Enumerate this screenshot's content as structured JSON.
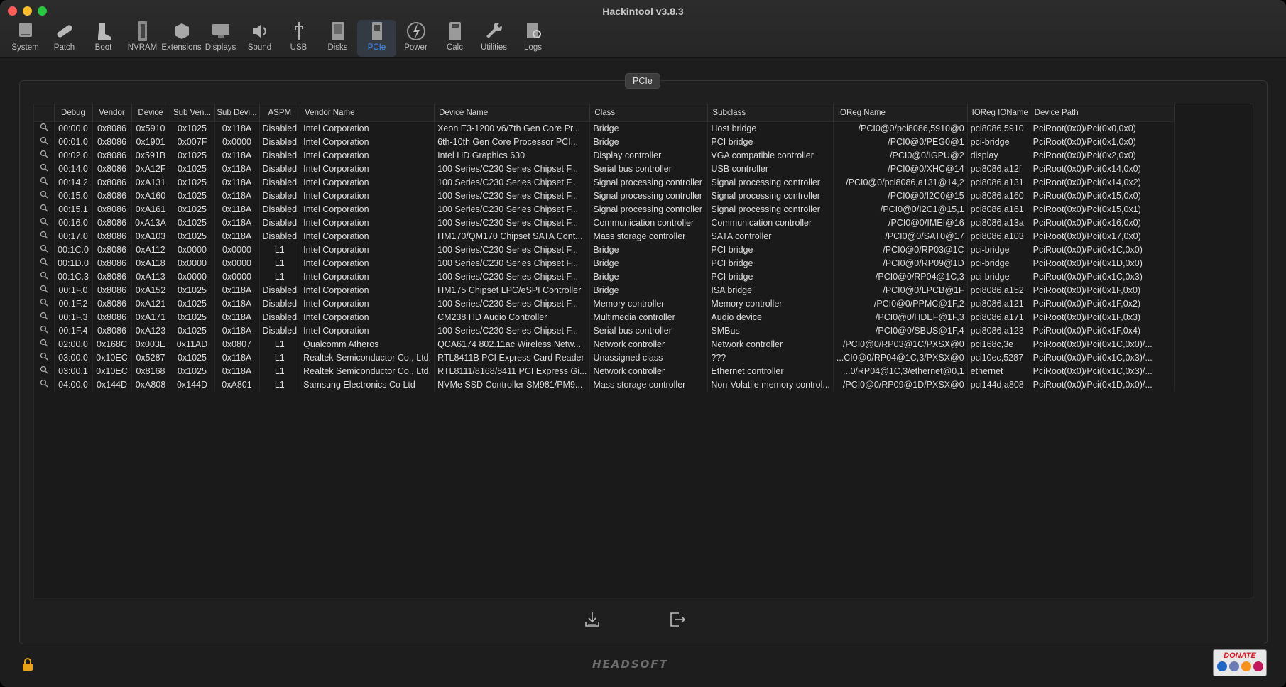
{
  "window": {
    "title": "Hackintool v3.8.3"
  },
  "toolbar": [
    {
      "label": "System",
      "icon": "system-icon"
    },
    {
      "label": "Patch",
      "icon": "patch-icon"
    },
    {
      "label": "Boot",
      "icon": "boot-icon"
    },
    {
      "label": "NVRAM",
      "icon": "nvram-icon"
    },
    {
      "label": "Extensions",
      "icon": "extensions-icon"
    },
    {
      "label": "Displays",
      "icon": "displays-icon"
    },
    {
      "label": "Sound",
      "icon": "sound-icon"
    },
    {
      "label": "USB",
      "icon": "usb-icon"
    },
    {
      "label": "Disks",
      "icon": "disks-icon"
    },
    {
      "label": "PCIe",
      "icon": "pcie-icon",
      "active": true
    },
    {
      "label": "Power",
      "icon": "power-icon"
    },
    {
      "label": "Calc",
      "icon": "calc-icon"
    },
    {
      "label": "Utilities",
      "icon": "utilities-icon"
    },
    {
      "label": "Logs",
      "icon": "logs-icon"
    }
  ],
  "panel": {
    "title": "PCIe"
  },
  "table": {
    "columns": [
      "",
      "Debug",
      "Vendor",
      "Device",
      "Sub Ven...",
      "Sub Devi...",
      "ASPM",
      "Vendor Name",
      "Device Name",
      "Class",
      "Subclass",
      "IOReg Name",
      "IOReg IOName",
      "Device Path"
    ],
    "rows": [
      [
        "00:00.0",
        "0x8086",
        "0x5910",
        "0x1025",
        "0x118A",
        "Disabled",
        "Intel Corporation",
        "Xeon E3-1200 v6/7th Gen Core Pr...",
        "Bridge",
        "Host bridge",
        "/PCI0@0/pci8086,5910@0",
        "pci8086,5910",
        "PciRoot(0x0)/Pci(0x0,0x0)"
      ],
      [
        "00:01.0",
        "0x8086",
        "0x1901",
        "0x007F",
        "0x0000",
        "Disabled",
        "Intel Corporation",
        "6th-10th Gen Core Processor PCI...",
        "Bridge",
        "PCI bridge",
        "/PCI0@0/PEG0@1",
        "pci-bridge",
        "PciRoot(0x0)/Pci(0x1,0x0)"
      ],
      [
        "00:02.0",
        "0x8086",
        "0x591B",
        "0x1025",
        "0x118A",
        "Disabled",
        "Intel Corporation",
        "Intel HD Graphics 630",
        "Display controller",
        "VGA compatible controller",
        "/PCI0@0/IGPU@2",
        "display",
        "PciRoot(0x0)/Pci(0x2,0x0)"
      ],
      [
        "00:14.0",
        "0x8086",
        "0xA12F",
        "0x1025",
        "0x118A",
        "Disabled",
        "Intel Corporation",
        "100 Series/C230 Series Chipset F...",
        "Serial bus controller",
        "USB controller",
        "/PCI0@0/XHC@14",
        "pci8086,a12f",
        "PciRoot(0x0)/Pci(0x14,0x0)"
      ],
      [
        "00:14.2",
        "0x8086",
        "0xA131",
        "0x1025",
        "0x118A",
        "Disabled",
        "Intel Corporation",
        "100 Series/C230 Series Chipset F...",
        "Signal processing controller",
        "Signal processing controller",
        "/PCI0@0/pci8086,a131@14,2",
        "pci8086,a131",
        "PciRoot(0x0)/Pci(0x14,0x2)"
      ],
      [
        "00:15.0",
        "0x8086",
        "0xA160",
        "0x1025",
        "0x118A",
        "Disabled",
        "Intel Corporation",
        "100 Series/C230 Series Chipset F...",
        "Signal processing controller",
        "Signal processing controller",
        "/PCI0@0/I2C0@15",
        "pci8086,a160",
        "PciRoot(0x0)/Pci(0x15,0x0)"
      ],
      [
        "00:15.1",
        "0x8086",
        "0xA161",
        "0x1025",
        "0x118A",
        "Disabled",
        "Intel Corporation",
        "100 Series/C230 Series Chipset F...",
        "Signal processing controller",
        "Signal processing controller",
        "/PCI0@0/I2C1@15,1",
        "pci8086,a161",
        "PciRoot(0x0)/Pci(0x15,0x1)"
      ],
      [
        "00:16.0",
        "0x8086",
        "0xA13A",
        "0x1025",
        "0x118A",
        "Disabled",
        "Intel Corporation",
        "100 Series/C230 Series Chipset F...",
        "Communication controller",
        "Communication controller",
        "/PCI0@0/IMEI@16",
        "pci8086,a13a",
        "PciRoot(0x0)/Pci(0x16,0x0)"
      ],
      [
        "00:17.0",
        "0x8086",
        "0xA103",
        "0x1025",
        "0x118A",
        "Disabled",
        "Intel Corporation",
        "HM170/QM170 Chipset SATA Cont...",
        "Mass storage controller",
        "SATA controller",
        "/PCI0@0/SAT0@17",
        "pci8086,a103",
        "PciRoot(0x0)/Pci(0x17,0x0)"
      ],
      [
        "00:1C.0",
        "0x8086",
        "0xA112",
        "0x0000",
        "0x0000",
        "L1",
        "Intel Corporation",
        "100 Series/C230 Series Chipset F...",
        "Bridge",
        "PCI bridge",
        "/PCI0@0/RP03@1C",
        "pci-bridge",
        "PciRoot(0x0)/Pci(0x1C,0x0)"
      ],
      [
        "00:1D.0",
        "0x8086",
        "0xA118",
        "0x0000",
        "0x0000",
        "L1",
        "Intel Corporation",
        "100 Series/C230 Series Chipset F...",
        "Bridge",
        "PCI bridge",
        "/PCI0@0/RP09@1D",
        "pci-bridge",
        "PciRoot(0x0)/Pci(0x1D,0x0)"
      ],
      [
        "00:1C.3",
        "0x8086",
        "0xA113",
        "0x0000",
        "0x0000",
        "L1",
        "Intel Corporation",
        "100 Series/C230 Series Chipset F...",
        "Bridge",
        "PCI bridge",
        "/PCI0@0/RP04@1C,3",
        "pci-bridge",
        "PciRoot(0x0)/Pci(0x1C,0x3)"
      ],
      [
        "00:1F.0",
        "0x8086",
        "0xA152",
        "0x1025",
        "0x118A",
        "Disabled",
        "Intel Corporation",
        "HM175 Chipset LPC/eSPI Controller",
        "Bridge",
        "ISA bridge",
        "/PCI0@0/LPCB@1F",
        "pci8086,a152",
        "PciRoot(0x0)/Pci(0x1F,0x0)"
      ],
      [
        "00:1F.2",
        "0x8086",
        "0xA121",
        "0x1025",
        "0x118A",
        "Disabled",
        "Intel Corporation",
        "100 Series/C230 Series Chipset F...",
        "Memory controller",
        "Memory controller",
        "/PCI0@0/PPMC@1F,2",
        "pci8086,a121",
        "PciRoot(0x0)/Pci(0x1F,0x2)"
      ],
      [
        "00:1F.3",
        "0x8086",
        "0xA171",
        "0x1025",
        "0x118A",
        "Disabled",
        "Intel Corporation",
        "CM238 HD Audio Controller",
        "Multimedia controller",
        "Audio device",
        "/PCI0@0/HDEF@1F,3",
        "pci8086,a171",
        "PciRoot(0x0)/Pci(0x1F,0x3)"
      ],
      [
        "00:1F.4",
        "0x8086",
        "0xA123",
        "0x1025",
        "0x118A",
        "Disabled",
        "Intel Corporation",
        "100 Series/C230 Series Chipset F...",
        "Serial bus controller",
        "SMBus",
        "/PCI0@0/SBUS@1F,4",
        "pci8086,a123",
        "PciRoot(0x0)/Pci(0x1F,0x4)"
      ],
      [
        "02:00.0",
        "0x168C",
        "0x003E",
        "0x11AD",
        "0x0807",
        "L1",
        "Qualcomm Atheros",
        "QCA6174 802.11ac Wireless Netw...",
        "Network controller",
        "Network controller",
        "/PCI0@0/RP03@1C/PXSX@0",
        "pci168c,3e",
        "PciRoot(0x0)/Pci(0x1C,0x0)/..."
      ],
      [
        "03:00.0",
        "0x10EC",
        "0x5287",
        "0x1025",
        "0x118A",
        "L1",
        "Realtek Semiconductor Co., Ltd.",
        "RTL8411B PCI Express Card Reader",
        "Unassigned class",
        "???",
        "...CI0@0/RP04@1C,3/PXSX@0",
        "pci10ec,5287",
        "PciRoot(0x0)/Pci(0x1C,0x3)/..."
      ],
      [
        "03:00.1",
        "0x10EC",
        "0x8168",
        "0x1025",
        "0x118A",
        "L1",
        "Realtek Semiconductor Co., Ltd.",
        "RTL8111/8168/8411 PCI Express Gi...",
        "Network controller",
        "Ethernet controller",
        "...0/RP04@1C,3/ethernet@0,1",
        "ethernet",
        "PciRoot(0x0)/Pci(0x1C,0x3)/..."
      ],
      [
        "04:00.0",
        "0x144D",
        "0xA808",
        "0x144D",
        "0xA801",
        "L1",
        "Samsung Electronics Co Ltd",
        "NVMe SSD Controller SM981/PM9...",
        "Mass storage controller",
        "Non-Volatile memory control...",
        "/PCI0@0/RP09@1D/PXSX@0",
        "pci144d,a808",
        "PciRoot(0x0)/Pci(0x1D,0x0)/..."
      ]
    ]
  },
  "footer": {
    "brand": "HEADSOFT",
    "donate": "DONATE"
  },
  "colors": {
    "accent": "#3b8cff",
    "background": "#1e1e1e"
  }
}
